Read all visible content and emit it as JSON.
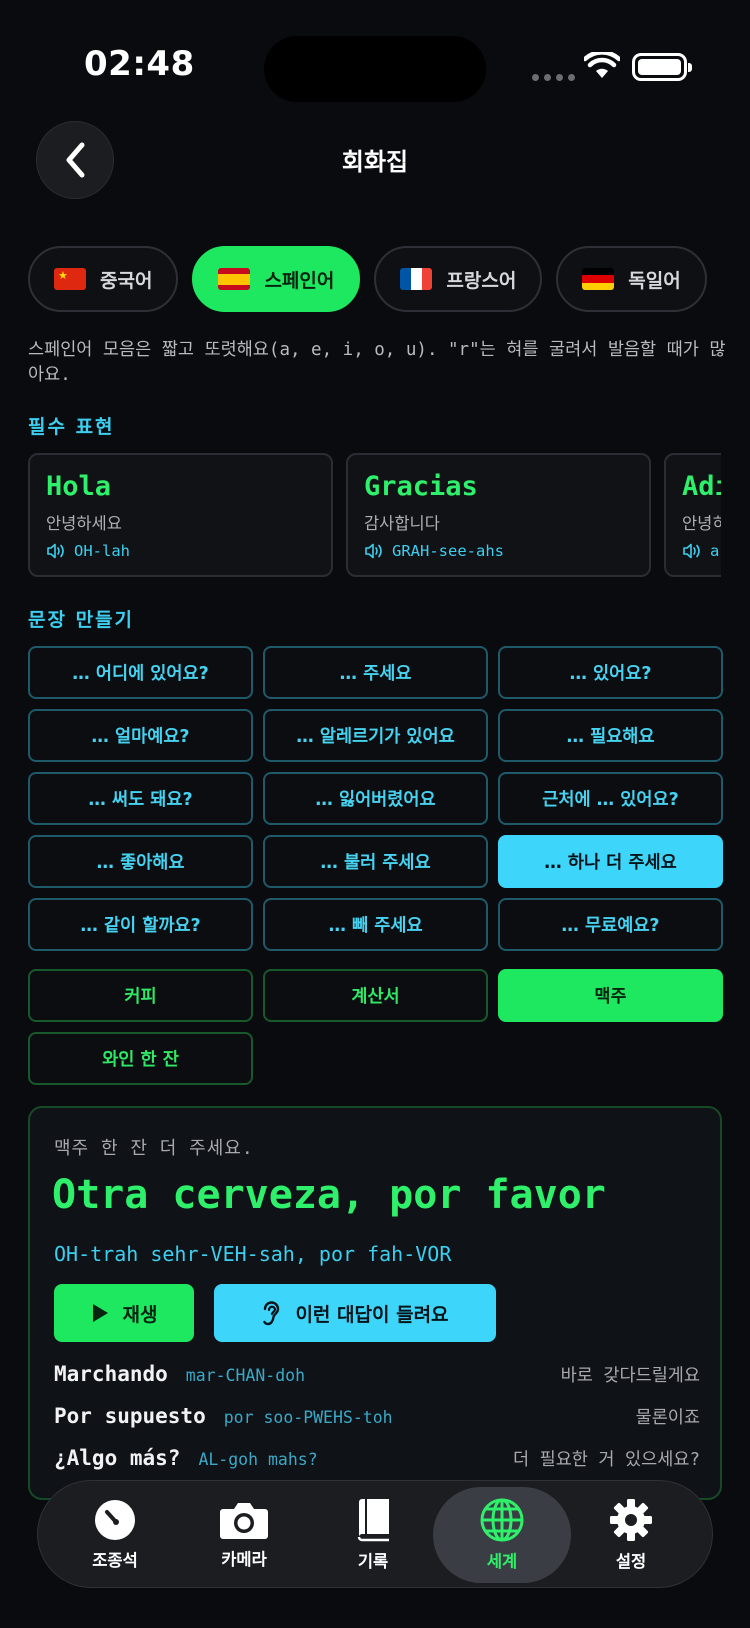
{
  "status": {
    "time": "02:48"
  },
  "header": {
    "title": "회화집",
    "back_icon": "chevron-left-icon"
  },
  "languages": [
    {
      "flag": "china",
      "label": "중국어",
      "active": false
    },
    {
      "flag": "spain",
      "label": "스페인어",
      "active": true
    },
    {
      "flag": "france",
      "label": "프랑스어",
      "active": false
    },
    {
      "flag": "germany",
      "label": "독일어",
      "active": false
    }
  ],
  "tip": "스페인어 모음은 짧고 또렷해요(a, e, i, o, u). \"r\"는 혀를 굴려서 발음할 때가 많아요.",
  "essentials": {
    "label": "필수 표현",
    "cards": [
      {
        "word": "Hola",
        "meaning": "안녕하세요",
        "pron": "OH-lah"
      },
      {
        "word": "Gracias",
        "meaning": "감사합니다",
        "pron": "GRAH-see-ahs"
      },
      {
        "word": "Adi",
        "meaning": "안녕히",
        "pron": "a"
      }
    ]
  },
  "builder": {
    "label": "문장 만들기",
    "patterns": [
      {
        "text": "… 어디에 있어요?",
        "active": false
      },
      {
        "text": "… 주세요",
        "active": false
      },
      {
        "text": "… 있어요?",
        "active": false
      },
      {
        "text": "… 얼마예요?",
        "active": false
      },
      {
        "text": "… 알레르기가 있어요",
        "active": false
      },
      {
        "text": "… 필요해요",
        "active": false
      },
      {
        "text": "… 써도 돼요?",
        "active": false
      },
      {
        "text": "… 잃어버렸어요",
        "active": false
      },
      {
        "text": "근처에 … 있어요?",
        "active": false
      },
      {
        "text": "… 좋아해요",
        "active": false
      },
      {
        "text": "… 불러 주세요",
        "active": false
      },
      {
        "text": "… 하나 더 주세요",
        "active": true
      },
      {
        "text": "… 같이 할까요?",
        "active": false
      },
      {
        "text": "… 빼 주세요",
        "active": false
      },
      {
        "text": "… 무료예요?",
        "active": false
      }
    ],
    "items": [
      {
        "text": "커피",
        "active": false
      },
      {
        "text": "계산서",
        "active": false
      },
      {
        "text": "맥주",
        "active": true
      },
      {
        "text": "와인 한 잔",
        "active": false
      }
    ]
  },
  "result": {
    "korean": "맥주 한 잔 더 주세요.",
    "phrase": "Otra cerveza, por favor",
    "pron": "OH-trah sehr-VEH-sah, por fah-VOR",
    "play_label": "재생",
    "hear_label": "이런 대답이 들려요",
    "replies": [
      {
        "es": "Marchando",
        "pron": "mar-CHAN-doh",
        "ko": "바로 갖다드릴게요"
      },
      {
        "es": "Por supuesto",
        "pron": "por soo-PWEHS-toh",
        "ko": "물론이죠"
      },
      {
        "es": "¿Algo más?",
        "pron": "AL-goh mahs?",
        "ko": "더 필요한 거 있으세요?"
      }
    ]
  },
  "tabs": [
    {
      "label": "조종석",
      "icon": "gauge-icon",
      "active": false
    },
    {
      "label": "카메라",
      "icon": "camera-icon",
      "active": false
    },
    {
      "label": "기록",
      "icon": "book-icon",
      "active": false
    },
    {
      "label": "세계",
      "icon": "globe-icon",
      "active": true
    },
    {
      "label": "설정",
      "icon": "gear-icon",
      "active": false
    }
  ],
  "colors": {
    "green": "#1ee860",
    "cyan": "#3dd6fa",
    "background": "#0a0b0e"
  }
}
